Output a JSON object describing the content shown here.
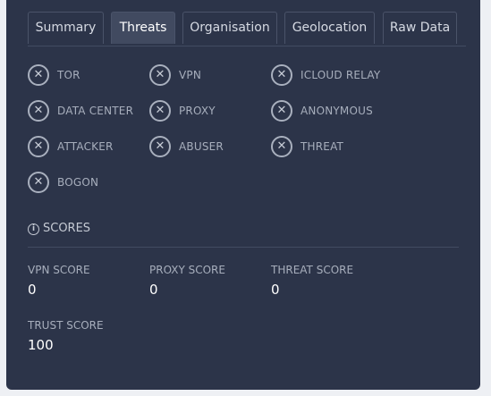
{
  "tabs": [
    {
      "label": "Summary"
    },
    {
      "label": "Threats"
    },
    {
      "label": "Organisation"
    },
    {
      "label": "Geolocation"
    },
    {
      "label": "Raw Data"
    }
  ],
  "active_tab": "Threats",
  "flags": [
    {
      "label": "TOR",
      "icon": "x-circle-icon"
    },
    {
      "label": "VPN",
      "icon": "x-circle-icon"
    },
    {
      "label": "ICLOUD RELAY",
      "icon": "x-circle-icon"
    },
    {
      "label": "DATA CENTER",
      "icon": "x-circle-icon"
    },
    {
      "label": "PROXY",
      "icon": "x-circle-icon"
    },
    {
      "label": "ANONYMOUS",
      "icon": "x-circle-icon"
    },
    {
      "label": "ATTACKER",
      "icon": "x-circle-icon"
    },
    {
      "label": "ABUSER",
      "icon": "x-circle-icon"
    },
    {
      "label": "THREAT",
      "icon": "x-circle-icon"
    },
    {
      "label": "BOGON",
      "icon": "x-circle-icon"
    }
  ],
  "scores": {
    "title": "SCORES",
    "icon": "info-icon",
    "items": [
      {
        "label": "VPN SCORE",
        "value": "0"
      },
      {
        "label": "PROXY SCORE",
        "value": "0"
      },
      {
        "label": "THREAT SCORE",
        "value": "0"
      },
      {
        "label": "TRUST SCORE",
        "value": "100"
      }
    ]
  },
  "colors": {
    "panel": "#2c3449",
    "active_tab": "#414a60",
    "text_muted": "#a7aebc",
    "text_value": "#ffffff"
  }
}
